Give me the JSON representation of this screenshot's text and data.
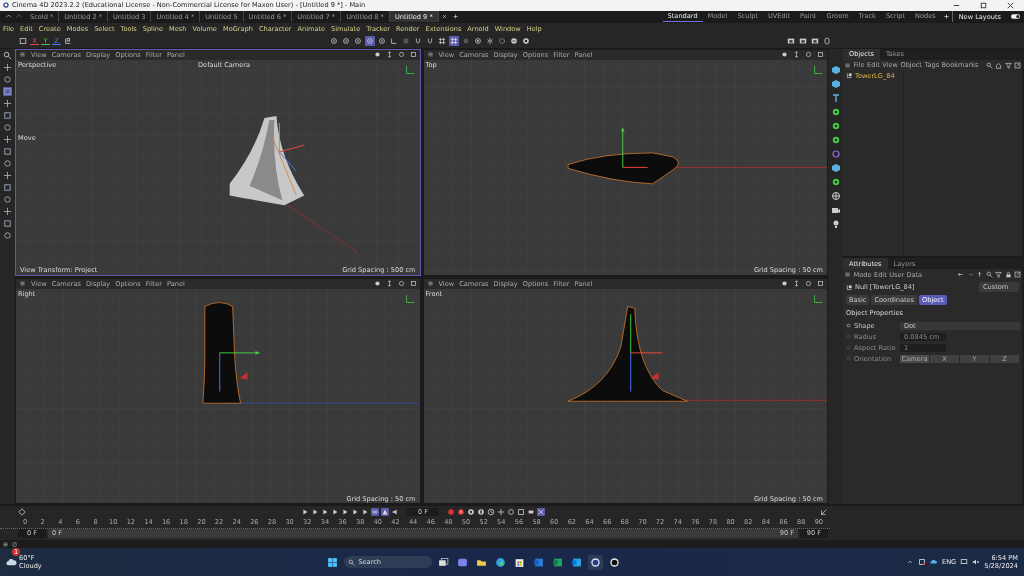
{
  "window": {
    "title": "Cinema 4D 2023.2.2 (Educational License - Non-Commercial License for Maxon User) - [Untitled 9 *] - Main"
  },
  "documents": [
    {
      "label": "Scold *",
      "selected": false
    },
    {
      "label": "Untitled 2 *",
      "selected": false
    },
    {
      "label": "Untitled 3",
      "selected": false
    },
    {
      "label": "Untitled 4 *",
      "selected": false
    },
    {
      "label": "Untitled 5",
      "selected": false
    },
    {
      "label": "Untitled 6 *",
      "selected": false
    },
    {
      "label": "Untitled 7 *",
      "selected": false
    },
    {
      "label": "Untitled 8 *",
      "selected": false
    },
    {
      "label": "Untitled 9 *",
      "selected": true
    }
  ],
  "layouts": [
    {
      "label": "Standard",
      "selected": true
    },
    {
      "label": "Model",
      "selected": false
    },
    {
      "label": "Sculpt",
      "selected": false
    },
    {
      "label": "UVEdit",
      "selected": false
    },
    {
      "label": "Paint",
      "selected": false
    },
    {
      "label": "Groom",
      "selected": false
    },
    {
      "label": "Track",
      "selected": false
    },
    {
      "label": "Script",
      "selected": false
    },
    {
      "label": "Nodes",
      "selected": false
    }
  ],
  "new_layouts": "New Layouts",
  "menu": [
    "File",
    "Edit",
    "Create",
    "Modes",
    "Select",
    "Tools",
    "Spline",
    "Mesh",
    "Volume",
    "MoGraph",
    "Character",
    "Animate",
    "Simulate",
    "Tracker",
    "Render",
    "Extensions",
    "Arnold",
    "Window",
    "Help"
  ],
  "axes": [
    {
      "label": "X",
      "color": "#e04848"
    },
    {
      "label": "Y",
      "color": "#4cc04c"
    },
    {
      "label": "Z",
      "color": "#4a7be0"
    }
  ],
  "viewports": [
    {
      "kind": "perspective",
      "active": true,
      "menu": [
        "View",
        "Cameras",
        "Display",
        "Options",
        "Filter",
        "Panel"
      ],
      "name": "Perspective",
      "camera": "Default Camera",
      "tool": "Move",
      "transform": "View Transform: Project",
      "grid": "Grid Spacing : 500 cm"
    },
    {
      "kind": "top",
      "active": false,
      "menu": [
        "View",
        "Cameras",
        "Display",
        "Options",
        "Filter",
        "Panel"
      ],
      "name": "Top",
      "grid": "Grid Spacing : 50 cm"
    },
    {
      "kind": "right",
      "active": false,
      "menu": [
        "View",
        "Cameras",
        "Display",
        "Options",
        "Filter",
        "Panel"
      ],
      "name": "Right",
      "grid": "Grid Spacing : 50 cm"
    },
    {
      "kind": "front",
      "active": false,
      "menu": [
        "View",
        "Cameras",
        "Display",
        "Options",
        "Filter",
        "Panel"
      ],
      "name": "Front",
      "grid": "Grid Spacing : 50 cm"
    }
  ],
  "objects": {
    "tabs": [
      {
        "label": "Objects",
        "selected": true
      },
      {
        "label": "Takes",
        "selected": false
      }
    ],
    "menu": [
      "File",
      "Edit",
      "View",
      "Object",
      "Tags",
      "Bookmarks"
    ],
    "items": [
      {
        "name": "TowerLG_84"
      }
    ]
  },
  "attributes": {
    "tabs": [
      {
        "label": "Attributes",
        "selected": true
      },
      {
        "label": "Layers",
        "selected": false
      }
    ],
    "menu": [
      "Mode",
      "Edit",
      "User Data"
    ],
    "object": "Null [TowerLG_84]",
    "preset": "Custom",
    "subtabs": [
      {
        "label": "Basic",
        "selected": false
      },
      {
        "label": "Coordinates",
        "selected": false
      },
      {
        "label": "Object",
        "selected": true
      }
    ],
    "section": "Object Properties",
    "fields": [
      {
        "kind": "dropdown",
        "label": "Shape",
        "value": "Dot",
        "disabled": false
      },
      {
        "kind": "number",
        "label": "Radius",
        "value": "0.0845 cm",
        "disabled": true
      },
      {
        "kind": "number",
        "label": "Aspect Ratio",
        "value": "1",
        "disabled": true
      },
      {
        "kind": "segmented",
        "label": "Orientation",
        "disabled": true,
        "options": [
          {
            "label": "Camera",
            "selected": true
          },
          {
            "label": "X",
            "selected": false
          },
          {
            "label": "Y",
            "selected": false
          },
          {
            "label": "Z",
            "selected": false
          }
        ]
      }
    ]
  },
  "timeline": {
    "frame": "0 F",
    "ticks": [
      "0",
      "2",
      "4",
      "6",
      "8",
      "10",
      "12",
      "14",
      "16",
      "18",
      "20",
      "22",
      "24",
      "26",
      "28",
      "30",
      "32",
      "34",
      "36",
      "38",
      "40",
      "42",
      "44",
      "46",
      "48",
      "50",
      "52",
      "54",
      "56",
      "58",
      "60",
      "62",
      "64",
      "66",
      "68",
      "70",
      "72",
      "74",
      "76",
      "78",
      "80",
      "82",
      "84",
      "86",
      "88",
      "90"
    ],
    "start": "0 F",
    "range_start": "0 F",
    "range_end": "90 F",
    "end": "90 F"
  },
  "taskbar": {
    "temperature": "60°F",
    "condition": "Cloudy",
    "badge": "1",
    "search": "Search",
    "language": "ENG",
    "time": "6:54 PM",
    "date": "5/28/2024"
  }
}
